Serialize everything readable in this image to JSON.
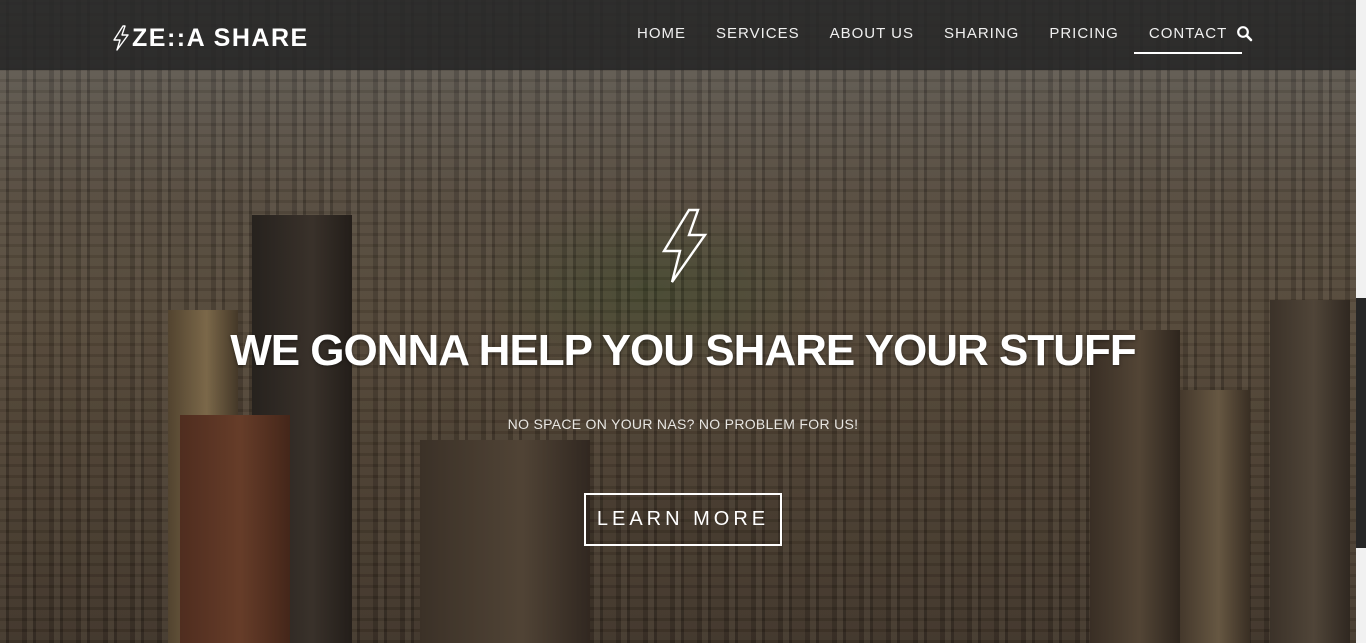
{
  "brand": {
    "name": "ZE::A SHARE",
    "icon": "lightning-bolt-icon"
  },
  "nav": {
    "items": [
      {
        "label": "HOME"
      },
      {
        "label": "SERVICES"
      },
      {
        "label": "ABOUT US"
      },
      {
        "label": "SHARING"
      },
      {
        "label": "PRICING"
      },
      {
        "label": "CONTACT"
      }
    ],
    "active": "CONTACT",
    "search_icon": "search-icon"
  },
  "hero": {
    "icon": "lightning-bolt-icon",
    "headline": "WE GONNA HELP YOU SHARE YOUR STUFF",
    "subline": "NO SPACE ON YOUR NAS? NO PROBLEM FOR US!",
    "cta_label": "LEARN MORE"
  },
  "colors": {
    "navbar": "#262626",
    "text": "#ffffff"
  }
}
